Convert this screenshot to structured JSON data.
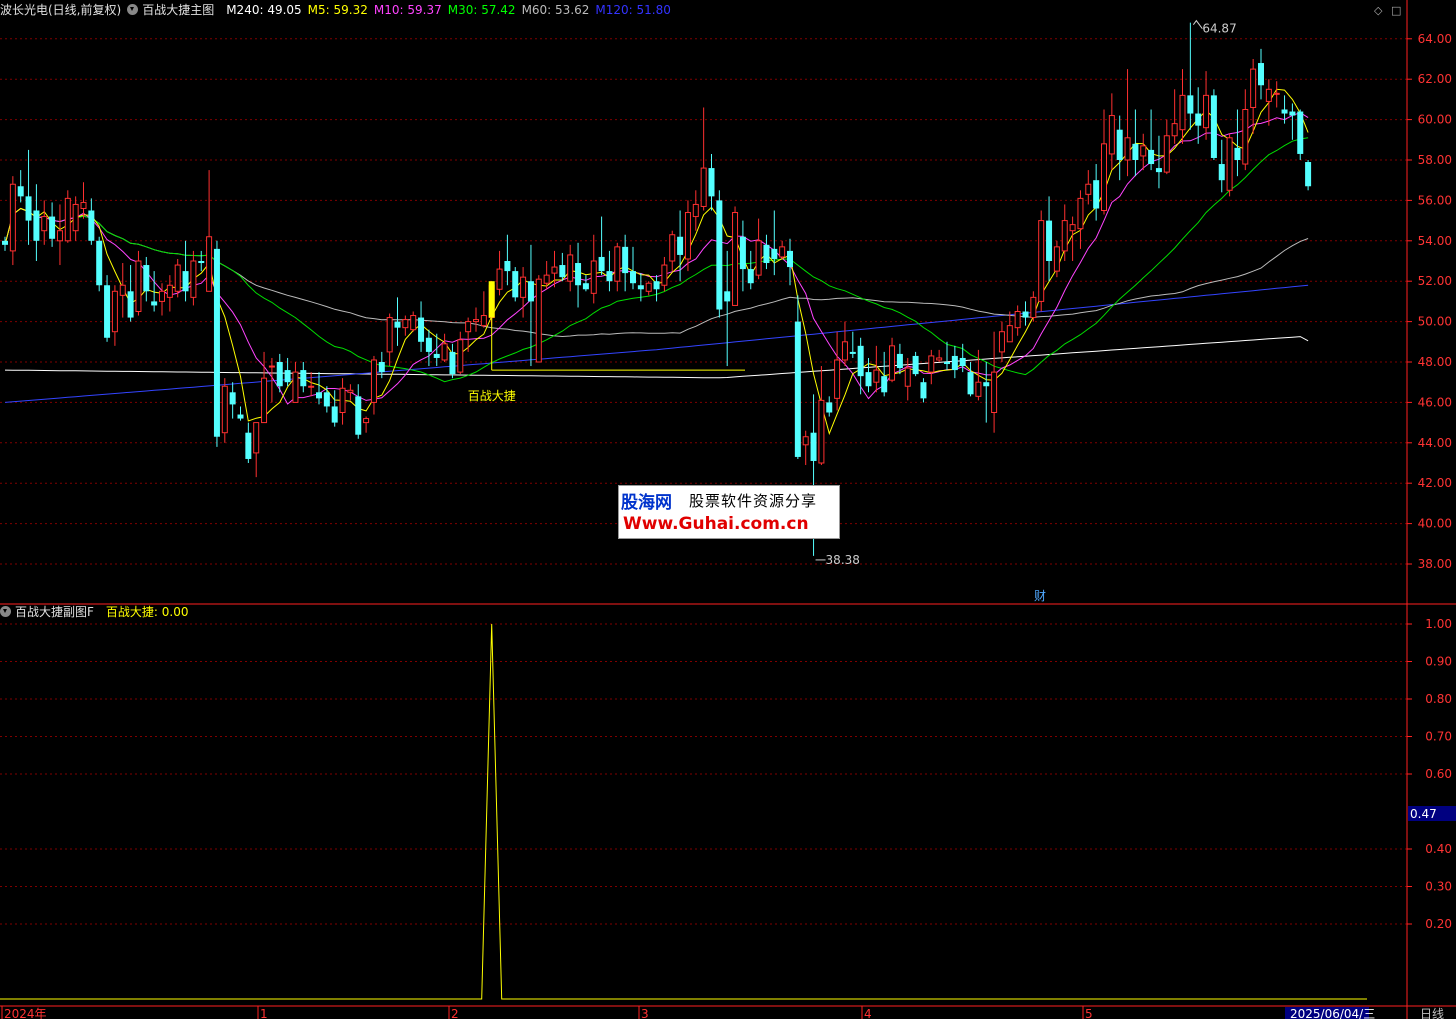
{
  "main_header": {
    "stock": "波长光电(日线,前复权)",
    "indicator": "百战大捷主图",
    "ma": [
      {
        "label": "M240: 49.05",
        "color": "#ffffff"
      },
      {
        "label": "M5: 59.32",
        "color": "#ffff00"
      },
      {
        "label": "M10: 59.37",
        "color": "#ff44ff"
      },
      {
        "label": "M30: 57.42",
        "color": "#00ff00"
      },
      {
        "label": "M60: 53.62",
        "color": "#bbbbbb"
      },
      {
        "label": "M120: 51.80",
        "color": "#3333ff"
      }
    ]
  },
  "sub_header": {
    "indicator": "百战大捷副图F",
    "value_label": "百战大捷: 0.00"
  },
  "price_axis": [
    "64.00",
    "62.00",
    "60.00",
    "58.00",
    "56.00",
    "54.00",
    "52.00",
    "50.00",
    "48.00",
    "46.00",
    "44.00",
    "42.00",
    "40.00",
    "38.00"
  ],
  "sub_axis": [
    "1.00",
    "0.90",
    "0.80",
    "0.70",
    "0.60",
    "0.40",
    "0.30",
    "0.20"
  ],
  "sub_cursor_value": "0.47",
  "max_label": "64.87",
  "min_label": "38.38",
  "signal_label": "百战大捷",
  "finance_mark": "财",
  "date_labels": {
    "start": "2024年",
    "m1": "1",
    "m2": "2",
    "m3": "3",
    "m4": "4",
    "m5": "5",
    "current": "2025/06/04/三"
  },
  "period_button": "日线",
  "window_controls": {
    "restore": "◇",
    "maximize": "□"
  },
  "watermark": {
    "brand": "股海网",
    "slogan": "股票软件资源分享",
    "url": "Www.Guhai.com.cn"
  },
  "colors": {
    "up": "#ff3030",
    "down": "#54ffff",
    "ma240": "#ffffff",
    "ma5": "#ffff00",
    "ma10": "#ff44ff",
    "ma30": "#00dd00",
    "ma60": "#bbbbbb",
    "ma120": "#3344ff",
    "grid": "#800000",
    "axis": "#ff2020"
  },
  "chart_data": [
    {
      "type": "candlestick",
      "title": "波长光电(日线,前复权)",
      "ylim": [
        37,
        65.5
      ],
      "ohlc": [
        [
          54.0,
          54.2,
          53.5,
          53.8
        ],
        [
          53.5,
          57.2,
          52.8,
          56.8
        ],
        [
          56.7,
          57.5,
          55.9,
          56.2
        ],
        [
          56.2,
          58.5,
          53.8,
          55.0
        ],
        [
          55.5,
          56.8,
          53.0,
          54.0
        ],
        [
          54.5,
          56.0,
          53.8,
          55.2
        ],
        [
          55.2,
          55.9,
          53.7,
          54.1
        ],
        [
          54.0,
          55.8,
          52.8,
          54.5
        ],
        [
          54.0,
          56.5,
          53.9,
          56.1
        ],
        [
          54.5,
          56.2,
          54.0,
          55.8
        ],
        [
          55.6,
          56.9,
          55.1,
          55.9
        ],
        [
          55.5,
          56.1,
          53.8,
          54.0
        ],
        [
          54.0,
          54.2,
          51.5,
          51.8
        ],
        [
          51.8,
          52.3,
          49.0,
          49.2
        ],
        [
          49.5,
          51.8,
          48.8,
          51.5
        ],
        [
          51.3,
          52.9,
          50.2,
          51.8
        ],
        [
          51.5,
          52.8,
          50.0,
          50.2
        ],
        [
          50.5,
          53.5,
          50.3,
          53.0
        ],
        [
          52.8,
          53.2,
          51.0,
          51.5
        ],
        [
          51.0,
          52.5,
          50.5,
          50.8
        ],
        [
          51.0,
          51.9,
          50.3,
          51.5
        ],
        [
          51.2,
          52.3,
          50.5,
          51.8
        ],
        [
          51.5,
          53.1,
          51.2,
          52.8
        ],
        [
          52.5,
          54.0,
          51.0,
          51.5
        ],
        [
          51.2,
          53.5,
          50.8,
          53.0
        ],
        [
          53.0,
          53.5,
          52.5,
          52.9
        ],
        [
          51.5,
          57.5,
          52.2,
          54.2
        ],
        [
          53.6,
          54.0,
          43.8,
          44.3
        ],
        [
          44.5,
          47.2,
          44.0,
          46.8
        ],
        [
          46.5,
          47.0,
          45.2,
          45.9
        ],
        [
          45.4,
          45.8,
          45.1,
          45.2
        ],
        [
          44.5,
          45.0,
          43.0,
          43.2
        ],
        [
          43.5,
          45.0,
          42.3,
          45.0
        ],
        [
          45.0,
          48.5,
          45.0,
          47.2
        ],
        [
          47.8,
          48.2,
          46.0,
          47.8
        ],
        [
          48.0,
          48.4,
          46.5,
          46.8
        ],
        [
          47.6,
          48.2,
          46.8,
          47.0
        ],
        [
          46.0,
          48.0,
          46.0,
          47.5
        ],
        [
          47.6,
          48.0,
          46.5,
          46.8
        ],
        [
          46.8,
          47.5,
          46.3,
          46.8
        ],
        [
          46.5,
          47.5,
          45.9,
          46.2
        ],
        [
          46.5,
          46.8,
          45.5,
          45.8
        ],
        [
          45.8,
          46.6,
          44.8,
          45.0
        ],
        [
          45.5,
          47.2,
          44.9,
          46.7
        ],
        [
          46.5,
          46.9,
          46.1,
          46.6
        ],
        [
          46.3,
          46.9,
          44.2,
          44.4
        ],
        [
          45.0,
          45.3,
          44.5,
          45.2
        ],
        [
          46.0,
          48.3,
          45.4,
          48.1
        ],
        [
          48.0,
          48.5,
          47.2,
          47.5
        ],
        [
          48.5,
          50.4,
          47.8,
          50.2
        ],
        [
          50.0,
          51.2,
          48.8,
          49.7
        ],
        [
          49.7,
          50.3,
          49.3,
          50.1
        ],
        [
          49.6,
          50.5,
          49.5,
          50.3
        ],
        [
          50.2,
          51.0,
          48.5,
          49.0
        ],
        [
          49.2,
          49.6,
          47.8,
          48.5
        ],
        [
          48.4,
          49.4,
          47.8,
          48.2
        ],
        [
          48.1,
          49.4,
          48.0,
          48.9
        ],
        [
          48.5,
          48.9,
          47.2,
          47.4
        ],
        [
          47.5,
          49.5,
          47.4,
          49.1
        ],
        [
          49.5,
          50.2,
          48.5,
          50.0
        ],
        [
          50.0,
          50.7,
          49.5,
          50.1
        ],
        [
          49.8,
          51.5,
          49.7,
          50.3
        ],
        [
          50.2,
          52.0,
          49.8,
          51.8
        ],
        [
          51.6,
          53.5,
          51.3,
          52.6
        ],
        [
          53.0,
          54.3,
          51.8,
          52.5
        ],
        [
          52.5,
          52.7,
          51.0,
          51.2
        ],
        [
          51.2,
          52.7,
          50.2,
          52.2
        ],
        [
          52.0,
          53.8,
          47.8,
          51.0
        ],
        [
          48.0,
          52.3,
          48.2,
          52.1
        ],
        [
          51.9,
          53.0,
          51.6,
          52.3
        ],
        [
          52.4,
          53.5,
          51.7,
          52.7
        ],
        [
          52.8,
          53.4,
          52.0,
          52.2
        ],
        [
          52.0,
          53.8,
          51.5,
          53.3
        ],
        [
          52.9,
          53.9,
          50.7,
          51.8
        ],
        [
          51.9,
          52.3,
          51.5,
          51.6
        ],
        [
          51.4,
          54.3,
          50.9,
          53.0
        ],
        [
          53.2,
          55.2,
          52.3,
          52.5
        ],
        [
          52.5,
          53.5,
          51.5,
          52.0
        ],
        [
          52.0,
          53.9,
          51.5,
          53.7
        ],
        [
          53.7,
          54.3,
          51.5,
          52.4
        ],
        [
          52.5,
          53.7,
          51.6,
          51.9
        ],
        [
          51.8,
          52.4,
          51.0,
          51.6
        ],
        [
          51.5,
          52.0,
          51.3,
          51.9
        ],
        [
          52.0,
          52.3,
          51.0,
          51.6
        ],
        [
          51.8,
          53.2,
          51.5,
          52.8
        ],
        [
          53.0,
          54.5,
          52.5,
          54.3
        ],
        [
          54.2,
          55.5,
          52.0,
          53.3
        ],
        [
          53.1,
          56.0,
          52.5,
          55.4
        ],
        [
          55.2,
          56.5,
          54.5,
          55.8
        ],
        [
          55.7,
          60.6,
          55.5,
          57.6
        ],
        [
          57.6,
          58.3,
          55.5,
          56.2
        ],
        [
          56.0,
          56.5,
          50.2,
          50.6
        ],
        [
          51.5,
          53.5,
          47.8,
          51.0
        ],
        [
          50.8,
          55.7,
          50.8,
          55.4
        ],
        [
          54.2,
          55.0,
          51.5,
          52.6
        ],
        [
          52.6,
          53.5,
          51.6,
          51.9
        ],
        [
          52.3,
          55.1,
          52.1,
          54.0
        ],
        [
          53.8,
          54.3,
          52.6,
          52.9
        ],
        [
          53.6,
          55.5,
          52.3,
          53.1
        ],
        [
          53.2,
          54.0,
          53.1,
          53.7
        ],
        [
          53.5,
          54.1,
          51.8,
          52.7
        ],
        [
          50.0,
          51.3,
          43.2,
          43.3
        ],
        [
          43.9,
          44.6,
          42.9,
          44.3
        ],
        [
          44.5,
          46.4,
          38.4,
          43.1
        ],
        [
          43.0,
          47.8,
          42.9,
          46.1
        ],
        [
          46.0,
          46.3,
          45.3,
          45.5
        ],
        [
          46.2,
          49.5,
          45.6,
          48.1
        ],
        [
          48.1,
          50.0,
          47.8,
          49.0
        ],
        [
          48.5,
          49.5,
          48.2,
          48.4
        ],
        [
          48.8,
          49.2,
          46.4,
          47.3
        ],
        [
          47.5,
          48.2,
          46.5,
          46.8
        ],
        [
          47.0,
          48.8,
          46.5,
          47.6
        ],
        [
          47.3,
          48.5,
          46.3,
          46.5
        ],
        [
          47.1,
          49.2,
          47.0,
          48.8
        ],
        [
          48.4,
          48.9,
          47.4,
          47.7
        ],
        [
          46.8,
          48.2,
          46.1,
          47.7
        ],
        [
          48.3,
          48.5,
          47.3,
          47.4
        ],
        [
          47.0,
          47.2,
          46.0,
          46.2
        ],
        [
          47.5,
          48.6,
          46.9,
          48.3
        ],
        [
          48.1,
          48.6,
          48.0,
          48.2
        ],
        [
          48.0,
          49.0,
          47.6,
          47.9
        ],
        [
          48.3,
          48.8,
          47.2,
          47.6
        ],
        [
          48.2,
          48.9,
          47.5,
          47.8
        ],
        [
          47.5,
          48.0,
          46.3,
          46.4
        ],
        [
          46.3,
          48.6,
          46.1,
          47.0
        ],
        [
          47.0,
          48.0,
          45.0,
          46.8
        ],
        [
          45.5,
          49.5,
          44.5,
          47.5
        ],
        [
          48.5,
          50.0,
          48.0,
          49.5
        ],
        [
          49.0,
          50.5,
          49.0,
          49.8
        ],
        [
          49.7,
          50.8,
          49.3,
          50.5
        ],
        [
          50.5,
          51.0,
          49.8,
          50.2
        ],
        [
          50.2,
          51.5,
          50.0,
          51.2
        ],
        [
          51.0,
          55.5,
          50.5,
          55.0
        ],
        [
          55.0,
          56.2,
          52.0,
          53.0
        ],
        [
          52.5,
          54.0,
          52.2,
          53.7
        ],
        [
          53.5,
          55.8,
          53.0,
          55.0
        ],
        [
          54.5,
          55.2,
          53.0,
          54.8
        ],
        [
          54.6,
          56.5,
          53.6,
          56.1
        ],
        [
          56.3,
          57.5,
          55.8,
          56.8
        ],
        [
          57.0,
          57.8,
          55.0,
          55.6
        ],
        [
          55.5,
          60.5,
          55.3,
          58.8
        ],
        [
          58.3,
          61.3,
          57.5,
          60.2
        ],
        [
          59.5,
          60.2,
          57.0,
          58.0
        ],
        [
          58.0,
          62.5,
          57.2,
          59.1
        ],
        [
          58.8,
          60.5,
          57.2,
          58.0
        ],
        [
          58.2,
          59.3,
          57.5,
          58.7
        ],
        [
          58.5,
          60.5,
          57.5,
          57.8
        ],
        [
          57.6,
          59.2,
          56.6,
          57.4
        ],
        [
          57.4,
          60.0,
          57.3,
          59.2
        ],
        [
          59.2,
          61.5,
          58.8,
          59.8
        ],
        [
          59.5,
          62.5,
          58.8,
          61.2
        ],
        [
          61.2,
          64.8,
          59.5,
          60.3
        ],
        [
          60.3,
          61.6,
          58.8,
          59.7
        ],
        [
          59.6,
          62.4,
          59.0,
          61.2
        ],
        [
          61.2,
          61.5,
          58.0,
          58.1
        ],
        [
          57.8,
          59.0,
          56.4,
          57.0
        ],
        [
          56.5,
          59.3,
          56.2,
          59.1
        ],
        [
          58.6,
          60.5,
          57.2,
          58.0
        ],
        [
          57.8,
          61.5,
          57.5,
          60.5
        ],
        [
          60.6,
          63.0,
          59.3,
          62.5
        ],
        [
          62.8,
          63.5,
          61.0,
          61.7
        ],
        [
          60.9,
          62.0,
          59.7,
          61.5
        ],
        [
          61.3,
          61.9,
          60.6,
          61.3
        ],
        [
          60.5,
          61.2,
          59.8,
          60.3
        ],
        [
          60.4,
          60.8,
          59.0,
          60.2
        ],
        [
          60.4,
          60.5,
          58.0,
          58.3
        ],
        [
          57.9,
          58.0,
          56.5,
          56.7
        ]
      ],
      "ma_values": {
        "M240": 49.05,
        "M5": 59.32,
        "M10": 59.37,
        "M30": 57.42,
        "M60": 53.62,
        "M120": 51.8
      },
      "signal": {
        "label": "百战大捷",
        "index": 62
      }
    },
    {
      "type": "line",
      "title": "百战大捷副图F",
      "ylim": [
        0,
        1.05
      ],
      "series": [
        {
          "name": "百战大捷",
          "spike_index": 62,
          "spike_value": 1.0,
          "baseline": 0.0
        }
      ]
    }
  ]
}
